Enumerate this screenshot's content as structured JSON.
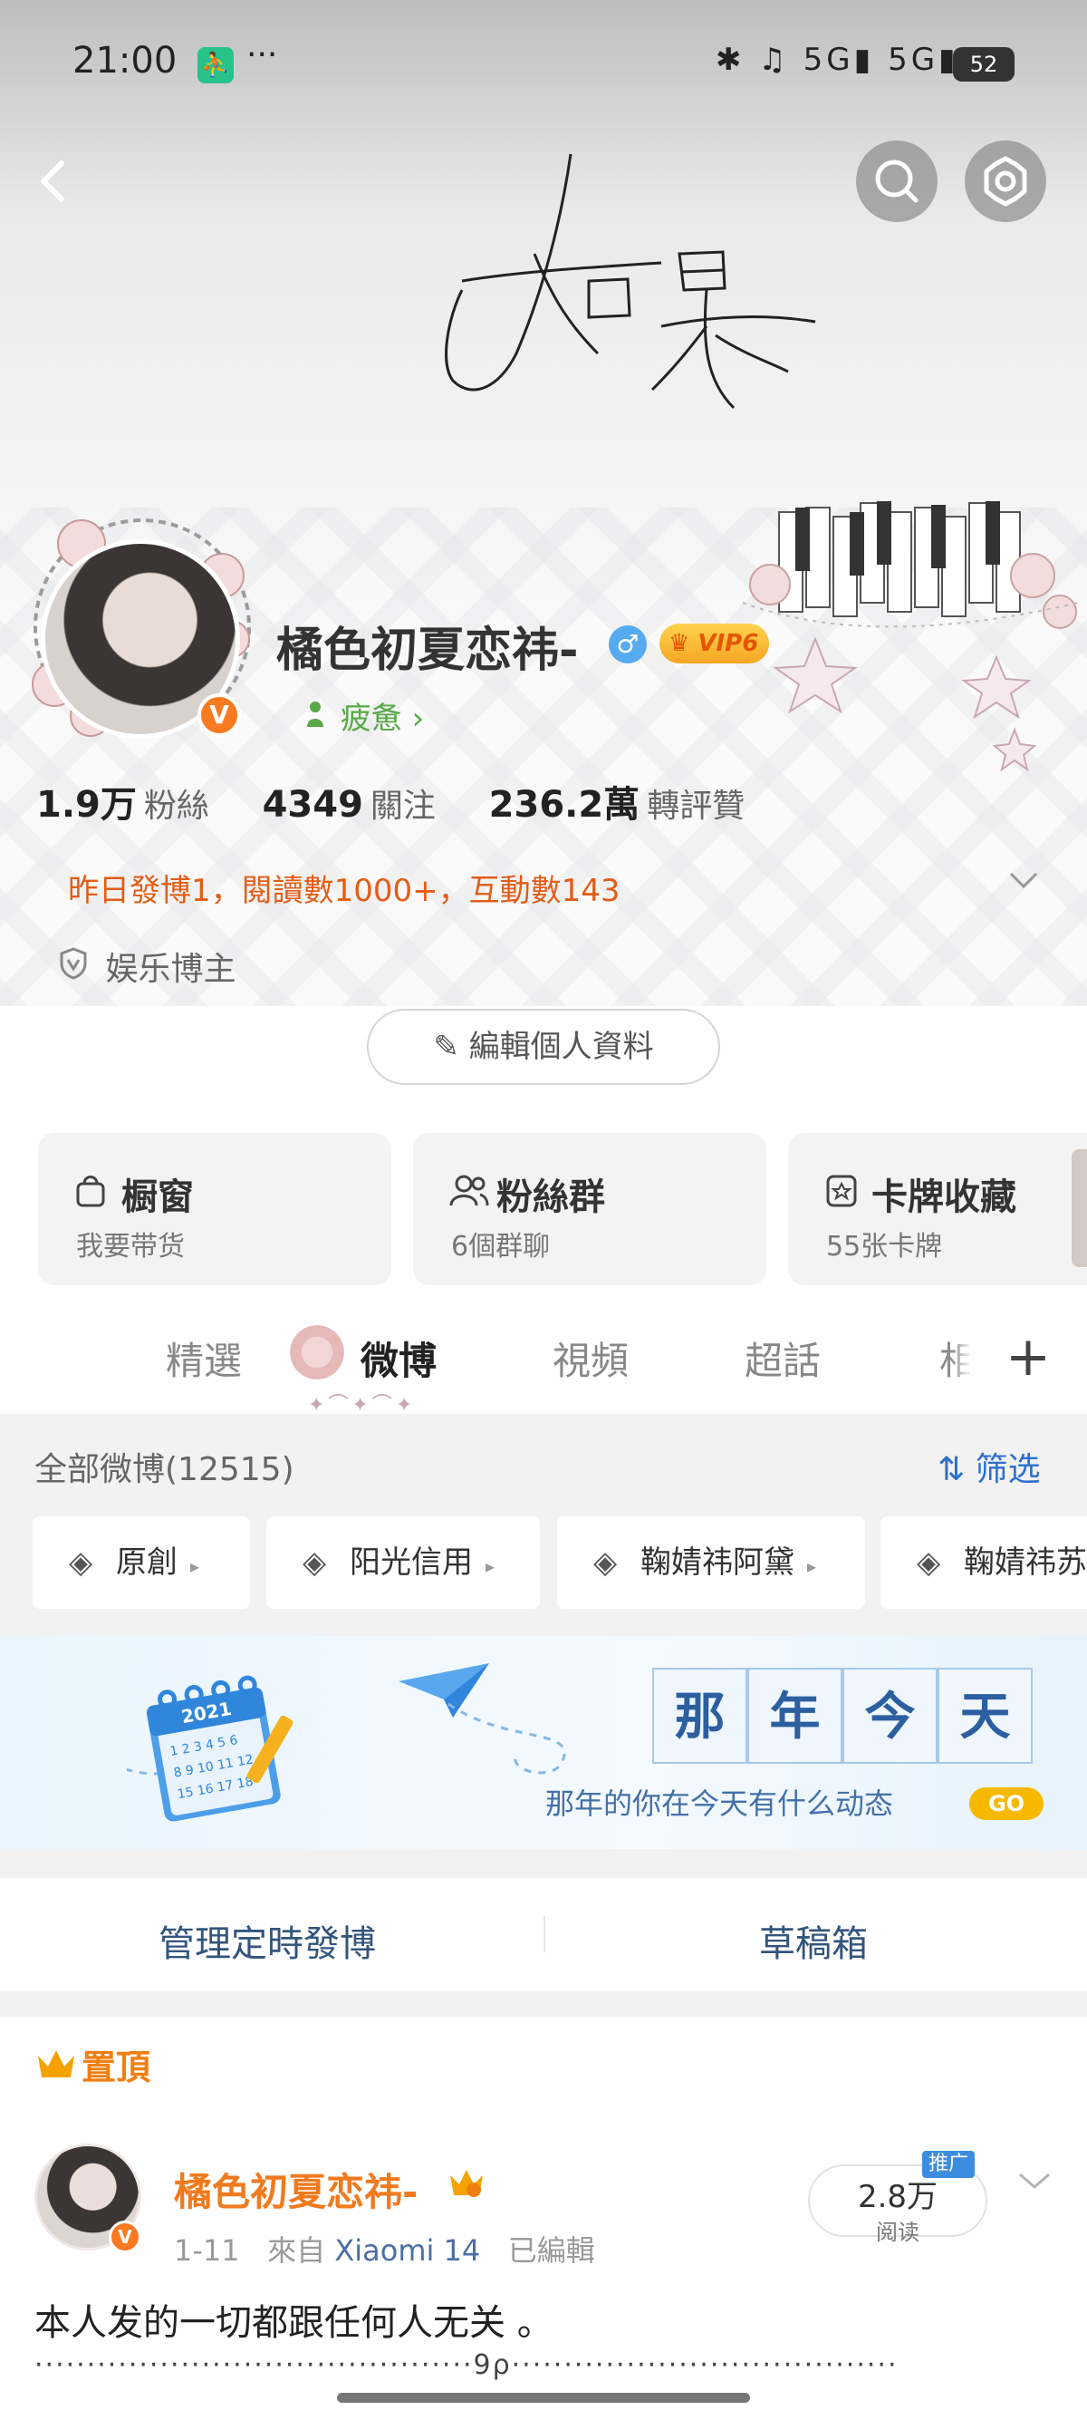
{
  "status_bar": {
    "time": "21:00",
    "app_badge": "⛹",
    "more": "···",
    "system_icons": "✱ ♫ 5G▮ 5G▮",
    "battery": "52"
  },
  "header": {
    "back_icon": "back-arrow-icon",
    "search_icon": "search-icon",
    "settings_icon": "gear-icon",
    "signature_text": "如果"
  },
  "profile": {
    "name": "橘色初夏恋祎-",
    "gender_symbol": "♂",
    "vip_label": "VIP6",
    "verified_mark": "V",
    "mood_label": "疲惫 ›",
    "stats": [
      {
        "value": "1.9万",
        "label": "粉絲"
      },
      {
        "value": "4349",
        "label": "關注"
      },
      {
        "value": "236.2萬",
        "label": "轉評贊"
      }
    ],
    "yesterday_summary": "昨日發博1，閱讀數1000+，互動數143",
    "blogger_tag": "娱乐博主",
    "edit_button": "編輯個人資料"
  },
  "cards": [
    {
      "title": "橱窗",
      "subtitle": "我要带货",
      "icon": "shopping-bag-icon"
    },
    {
      "title": "粉絲群",
      "subtitle": "6個群聊",
      "icon": "group-icon"
    },
    {
      "title": "卡牌收藏",
      "subtitle": "55张卡牌",
      "icon": "card-icon"
    }
  ],
  "tabs": [
    "精選",
    "微博",
    "視頻",
    "超話",
    "相"
  ],
  "active_tab": "微博",
  "feed_filter": {
    "all_label": "全部微博(12515)",
    "filter_label": "筛选",
    "chips": [
      "原創",
      "阳光信用",
      "鞠婧祎阿黛",
      "鞠婧祎苏"
    ]
  },
  "banner": {
    "calendar_year": "2021",
    "title_chars": [
      "那",
      "年",
      "今",
      "天"
    ],
    "subtitle": "那年的你在今天有什么动态",
    "go_label": "GO"
  },
  "actions": {
    "scheduled": "管理定時發博",
    "drafts": "草稿箱"
  },
  "post": {
    "pinned_label": "置頂",
    "author": "橘色初夏恋祎-",
    "date": "1-11",
    "from_label": "來自",
    "source": "Xiaomi 14",
    "edited_label": "已編輯",
    "reads_value": "2.8万",
    "reads_label": "阅读",
    "promo_label": "推广",
    "text": "本人发的一切都跟任何人无关 。",
    "dots_line": "··········································9ρ·····································"
  }
}
